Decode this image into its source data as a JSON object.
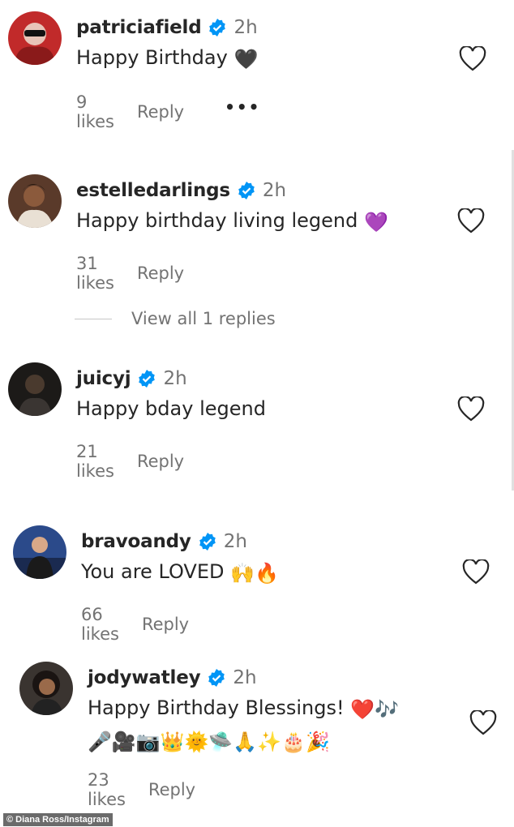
{
  "comments": [
    {
      "username": "patriciafield",
      "time": "2h",
      "text": "Happy Birthday",
      "emoji": "🖤",
      "likes": "9 likes",
      "reply": "Reply",
      "more": "•••",
      "avatar": "avatar-red-hair-sunglasses"
    },
    {
      "username": "estelledarlings",
      "time": "2h",
      "text": "Happy birthday living legend",
      "emoji": "💜",
      "likes": "31 likes",
      "reply": "Reply",
      "avatar": "avatar-portrait"
    },
    {
      "username": "juicyj",
      "time": "2h",
      "text": "Happy bday legend",
      "likes": "21 likes",
      "reply": "Reply",
      "avatar": "avatar-dark-portrait"
    },
    {
      "username": "bravoandy",
      "time": "2h",
      "text": "You are LOVED",
      "emoji": "🙌🔥",
      "likes": "66 likes",
      "reply": "Reply",
      "avatar": "avatar-stage-portrait"
    },
    {
      "username": "jodywatley",
      "time": "2h",
      "text": "Happy Birthday Blessings!",
      "emoji": "❤️🎶",
      "emoji_line2": "🎤🎥📷👑🌞🛸🙏✨🎂🎉",
      "likes": "23 likes",
      "reply": "Reply",
      "avatar": "avatar-curly-hair"
    }
  ],
  "view_replies": "View all 1 replies",
  "credit": "© Diana Ross/Instagram",
  "colors": {
    "verified": "#0095f6",
    "secondary_text": "#737373",
    "primary_text": "#262626"
  }
}
